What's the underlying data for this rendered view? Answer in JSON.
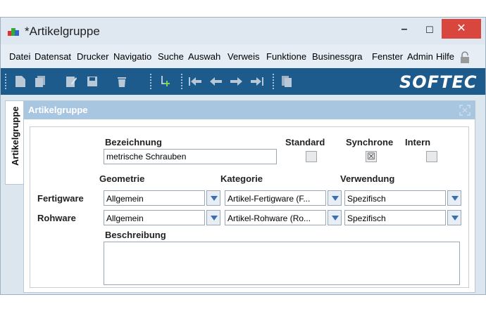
{
  "window": {
    "title": "*Artikelgruppe",
    "minimize": "–",
    "maximize": "☐",
    "close": "✕"
  },
  "menu": {
    "items": [
      "Datei",
      "Datensat",
      "Drucker",
      "Navigatio",
      "Suche",
      "Auswah",
      "Verweis",
      "Funktione",
      "Businessgra",
      "Fenster",
      "Admin",
      "Hilfe"
    ]
  },
  "toolbar": {
    "logo": "SOFTEC"
  },
  "sidetab": {
    "label": "Artikelgruppe"
  },
  "panel": {
    "title": "Artikelgruppe"
  },
  "form": {
    "bezeichnung_label": "Bezeichnung",
    "bezeichnung_value": "metrische Schrauben",
    "standard_label": "Standard",
    "synchrone_label": "Synchrone",
    "intern_label": "Intern",
    "standard_checked": false,
    "synchrone_checked": true,
    "intern_checked": false,
    "synchrone_mark": "☒",
    "geometrie_label": "Geometrie",
    "kategorie_label": "Kategorie",
    "verwendung_label": "Verwendung",
    "fertigware_label": "Fertigware",
    "rohware_label": "Rohware",
    "fertigware_geometrie": "Allgemein",
    "fertigware_kategorie": "Artikel-Fertigware (F...",
    "fertigware_verwendung": "Spezifisch",
    "rohware_geometrie": "Allgemein",
    "rohware_kategorie": "Artikel-Rohware (Ro...",
    "rohware_verwendung": "Spezifisch",
    "beschreibung_label": "Beschreibung",
    "beschreibung_value": ""
  },
  "colors": {
    "toolbar_bg": "#1d5b8d",
    "panel_header": "#a9c6e0",
    "close_btn": "#d9463e"
  }
}
